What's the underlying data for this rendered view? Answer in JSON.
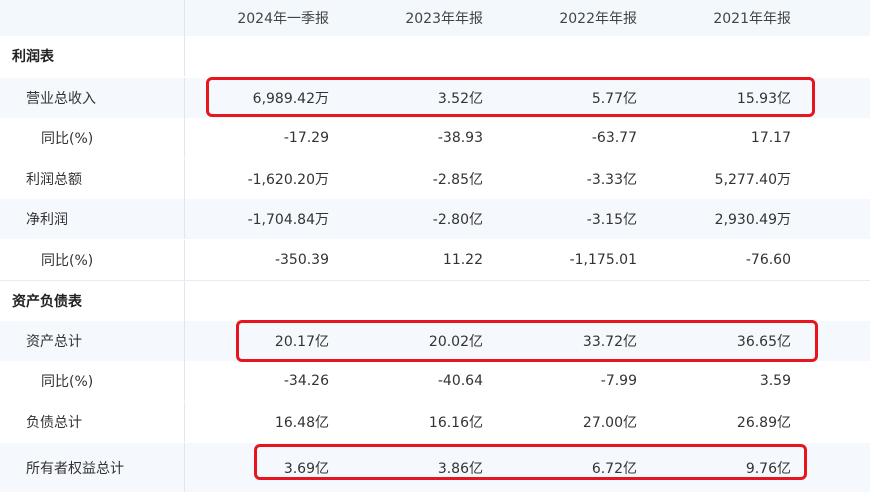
{
  "header": {
    "columns": [
      "2024年一季报",
      "2023年年报",
      "2022年年报",
      "2021年年报"
    ]
  },
  "sections": [
    {
      "title": "利润表",
      "rows": [
        {
          "label": "营业总收入",
          "level": 1,
          "values": [
            "6,989.42万",
            "3.52亿",
            "5.77亿",
            "15.93亿"
          ]
        },
        {
          "label": "同比(%)",
          "level": 2,
          "values": [
            "-17.29",
            "-38.93",
            "-63.77",
            "17.17"
          ]
        },
        {
          "label": "利润总额",
          "level": 1,
          "values": [
            "-1,620.20万",
            "-2.85亿",
            "-3.33亿",
            "5,277.40万"
          ]
        },
        {
          "label": "净利润",
          "level": 1,
          "values": [
            "-1,704.84万",
            "-2.80亿",
            "-3.15亿",
            "2,930.49万"
          ]
        },
        {
          "label": "同比(%)",
          "level": 2,
          "values": [
            "-350.39",
            "11.22",
            "-1,175.01",
            "-76.60"
          ]
        }
      ]
    },
    {
      "title": "资产负债表",
      "rows": [
        {
          "label": "资产总计",
          "level": 1,
          "values": [
            "20.17亿",
            "20.02亿",
            "33.72亿",
            "36.65亿"
          ]
        },
        {
          "label": "同比(%)",
          "level": 2,
          "values": [
            "-34.26",
            "-40.64",
            "-7.99",
            "3.59"
          ]
        },
        {
          "label": "负债总计",
          "level": 1,
          "values": [
            "16.48亿",
            "16.16亿",
            "27.00亿",
            "26.89亿"
          ]
        },
        {
          "label": "所有者权益总计",
          "level": 1,
          "values": [
            "3.69亿",
            "3.86亿",
            "6.72亿",
            "9.76亿"
          ]
        }
      ]
    }
  ],
  "highlight_color": "#e8141e"
}
